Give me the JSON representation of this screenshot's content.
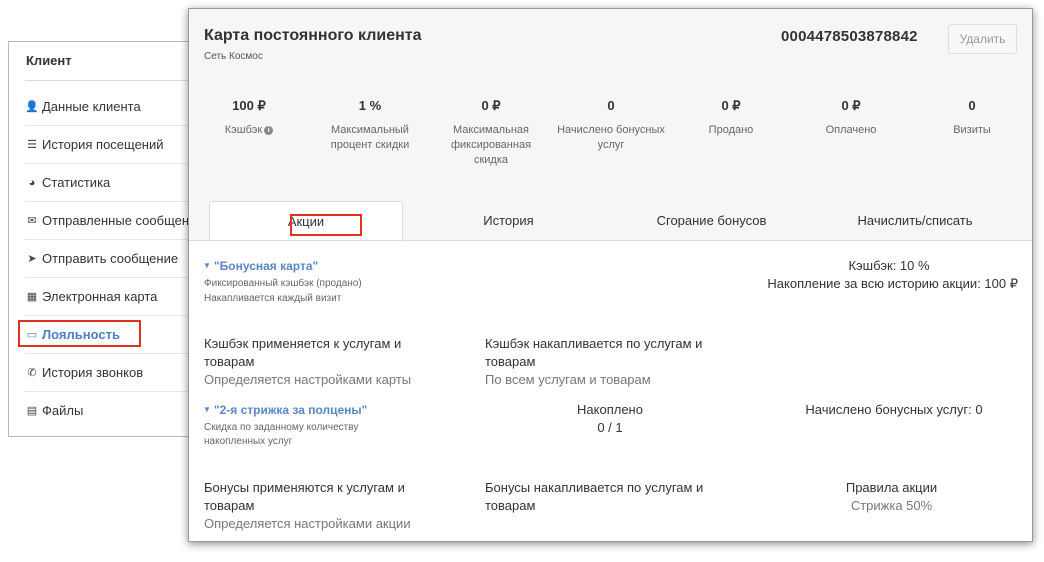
{
  "client_sidebar": {
    "title": "Клиент",
    "items": [
      {
        "icon": "user-icon",
        "glyph": "👤",
        "label": "Данные клиента"
      },
      {
        "icon": "list-icon",
        "glyph": "☰",
        "label": "История посещений"
      },
      {
        "icon": "pie-chart-icon",
        "glyph": "◕",
        "label": "Статистика"
      },
      {
        "icon": "envelope-icon",
        "glyph": "✉",
        "label": "Отправленные сообщения"
      },
      {
        "icon": "send-icon",
        "glyph": "➤",
        "label": "Отправить сообщение"
      },
      {
        "icon": "qr-code-icon",
        "glyph": "▦",
        "label": "Электронная карта"
      },
      {
        "icon": "credit-card-icon",
        "glyph": "▭",
        "label": "Лояльность"
      },
      {
        "icon": "phone-icon",
        "glyph": "✆",
        "label": "История звонков"
      },
      {
        "icon": "file-icon",
        "glyph": "▤",
        "label": "Файлы"
      }
    ],
    "active_index": 6,
    "active_color": "#4a80c8"
  },
  "card": {
    "title": "Карта постоянного клиента",
    "network": "Сеть Космос",
    "number": "0004478503878842",
    "delete_label": "Удалить",
    "stats": [
      {
        "value": "100 ₽",
        "label": "Кэшбэк",
        "has_info_icon": true
      },
      {
        "value": "1 %",
        "label": "Максимальный процент скидки"
      },
      {
        "value": "0 ₽",
        "label": "Максимальная фиксированная скидка"
      },
      {
        "value": "0",
        "label": "Начислено бонусных услуг"
      },
      {
        "value": "0 ₽",
        "label": "Продано"
      },
      {
        "value": "0 ₽",
        "label": "Оплачено"
      },
      {
        "value": "0",
        "label": "Визиты"
      }
    ],
    "tabs": [
      "Акции",
      "История",
      "Сгорание бонусов",
      "Начислить/списать"
    ],
    "active_tab": 0,
    "highlight_color": "#e0301e"
  },
  "promos": [
    {
      "name": "\"Бонусная карта\"",
      "type_line1": "Фиксированный кэшбэк (продано)",
      "type_line2": "Накапливается каждый визит",
      "cashback_label": "Кэшбэк: 10 %",
      "accumulation_label": "Накопление за всю историю акции: 100 ₽",
      "apply_title": "Кэшбэк применяется к услугам и товарам",
      "apply_title_l1": "Кэшбэк применяется к услугам и",
      "apply_title_l2": "товарам",
      "apply_note": "Определяется настройками карты",
      "accrue_title_l1": "Кэшбэк накапливается по услугам и",
      "accrue_title_l2": "товарам",
      "accrue_note": "По всем услугам и товарам"
    },
    {
      "name": "\"2-я стрижка за полцены\"",
      "type_line1": "Скидка по заданному количеству",
      "type_line2": "накопленных услуг",
      "accumulated_label": "Накоплено",
      "accumulated_value": "0 / 1",
      "bonus_services_label": "Начислено бонусных услуг: 0",
      "apply_title_l1": "Бонусы применяются к услугам и",
      "apply_title_l2": "товарам",
      "apply_note": "Определяется настройками акции",
      "accrue_title_l1": "Бонусы накапливается по услугам и",
      "accrue_title_l2": "товарам",
      "rules_label": "Правила акции",
      "rules_value": "Стрижка 50%"
    }
  ]
}
